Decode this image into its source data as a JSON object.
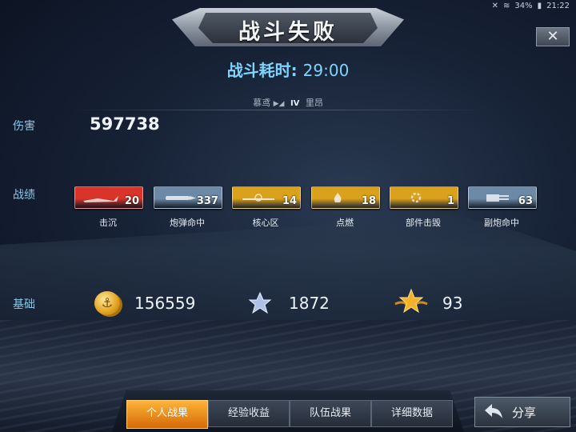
{
  "status": {
    "battery": "34%",
    "time": "21:22"
  },
  "title": "战斗失败",
  "battle_time": {
    "label": "战斗耗时:",
    "value": "29:00"
  },
  "player": {
    "name": "慕鸢",
    "tier": "IV",
    "ship": "里昂"
  },
  "close_label": "✕",
  "damage": {
    "label": "伤害",
    "value": "597738"
  },
  "achievements": {
    "label": "战绩",
    "items": [
      {
        "label": "击沉",
        "count": "20",
        "icon": "sink-icon",
        "color": "#d8342a"
      },
      {
        "label": "炮弹命中",
        "count": "337",
        "icon": "shell-hit-icon",
        "color": "#6c8aa6"
      },
      {
        "label": "核心区",
        "count": "14",
        "icon": "citadel-icon",
        "color": "#d9a11c"
      },
      {
        "label": "点燃",
        "count": "18",
        "icon": "fire-icon",
        "color": "#d9a11c"
      },
      {
        "label": "部件击毁",
        "count": "1",
        "icon": "module-destroy-icon",
        "color": "#d9a11c"
      },
      {
        "label": "副炮命中",
        "count": "63",
        "icon": "secondary-hit-icon",
        "color": "#6c8aa6"
      }
    ]
  },
  "base": {
    "label": "基础",
    "credits": "156559",
    "exp": "1872",
    "free_exp": "93"
  },
  "tabs": [
    "个人战果",
    "经验收益",
    "队伍战果",
    "详细数据"
  ],
  "active_tab": 0,
  "share_label": "分享"
}
